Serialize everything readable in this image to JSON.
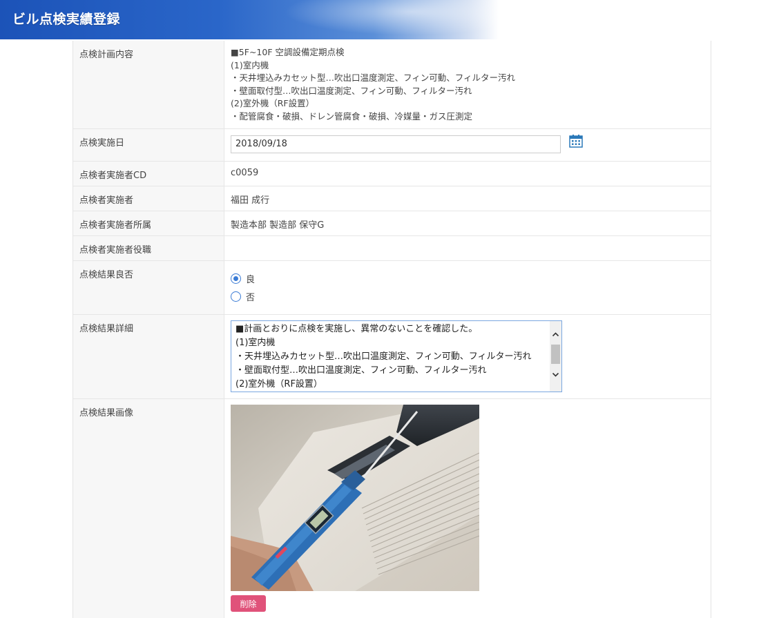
{
  "header": {
    "title": "ビル点検実績登録"
  },
  "form": {
    "plan": {
      "label": "点検計画内容",
      "lines": [
        "■5F~10F 空調設備定期点検",
        "(1)室内機",
        "・天井埋込みカセット型…吹出口温度測定、フィン可動、フィルター汚れ",
        "・壁面取付型…吹出口温度測定、フィン可動、フィルター汚れ",
        "(2)室外機（RF設置）",
        "・配管腐食・破損、ドレン管腐食・破損、冷媒量・ガス圧測定"
      ]
    },
    "date": {
      "label": "点検実施日",
      "value": "2018/09/18",
      "icon": "calendar-icon"
    },
    "inspector_cd": {
      "label": "点検者実施者CD",
      "value": "c0059"
    },
    "inspector": {
      "label": "点検者実施者",
      "value": "福田 成行"
    },
    "department": {
      "label": "点検者実施者所属",
      "value": "製造本部 製造部 保守G"
    },
    "position": {
      "label": "点検者実施者役職",
      "value": ""
    },
    "result": {
      "label": "点検結果良否",
      "options": [
        {
          "label": "良",
          "checked": true
        },
        {
          "label": "否",
          "checked": false
        }
      ]
    },
    "detail": {
      "label": "点検結果詳細",
      "lines": [
        "■計画とおりに点検を実施し、異常のないことを確認した。",
        "(1)室内機",
        "・天井埋込みカセット型…吹出口温度測定、フィン可動、フィルター汚れ",
        "・壁面取付型…吹出口温度測定、フィン可動、フィルター汚れ",
        "(2)室外機（RF設置）"
      ]
    },
    "image": {
      "label": "点検結果画像",
      "delete_label": "削除"
    }
  },
  "colors": {
    "accent": "#3a7bd5",
    "header_blue": "#1c53b8",
    "delete": "#e0527a"
  }
}
